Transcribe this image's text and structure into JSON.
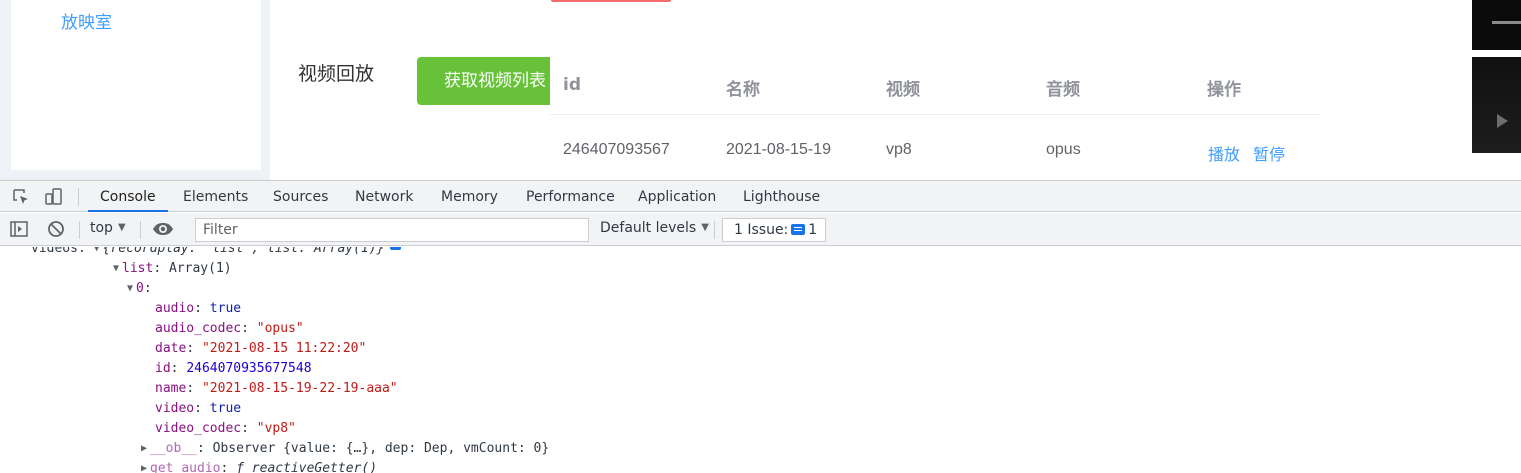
{
  "webpage": {
    "sidebar": {
      "items": [
        {
          "label": "放映室"
        }
      ]
    },
    "replay_label": "视频回放",
    "fetch_button": "获取视频列表",
    "table": {
      "headers": [
        "id",
        "名称",
        "视频",
        "音频",
        "操作"
      ],
      "rows": [
        {
          "id": "246407093567",
          "name": "2021-08-15-19",
          "video": "vp8",
          "audio": "opus",
          "actions": [
            "播放",
            "暂停"
          ]
        }
      ]
    }
  },
  "devtools": {
    "tabs": [
      "Console",
      "Elements",
      "Sources",
      "Network",
      "Memory",
      "Performance",
      "Application",
      "Lighthouse"
    ],
    "active_tab": "Console",
    "context": "top",
    "filter_placeholder": "Filter",
    "levels": "Default levels",
    "issues_label": "1 Issue:",
    "issues_count": "1",
    "console": {
      "videos_line": {
        "key": "videos",
        "value": "{recordplay: 'list', list: Array(1)}"
      },
      "list_line": {
        "key": "list",
        "value": "Array(1)"
      },
      "item_index": "0",
      "props": [
        {
          "key": "audio",
          "value": "true",
          "kind": "bool"
        },
        {
          "key": "audio_codec",
          "value": "\"opus\"",
          "kind": "str"
        },
        {
          "key": "date",
          "value": "\"2021-08-15 11:22:20\"",
          "kind": "str"
        },
        {
          "key": "id",
          "value": "2464070935677548",
          "kind": "num"
        },
        {
          "key": "name",
          "value": "\"2021-08-15-19-22-19-aaa\"",
          "kind": "str"
        },
        {
          "key": "video",
          "value": "true",
          "kind": "bool"
        },
        {
          "key": "video_codec",
          "value": "\"vp8\"",
          "kind": "str"
        }
      ],
      "ob_line": {
        "key": "__ob__",
        "value": "Observer {value: {…}, dep: Dep, vmCount: 0}"
      },
      "getter_line": {
        "key": "get audio",
        "value": "ƒ reactiveGetter()"
      }
    }
  }
}
